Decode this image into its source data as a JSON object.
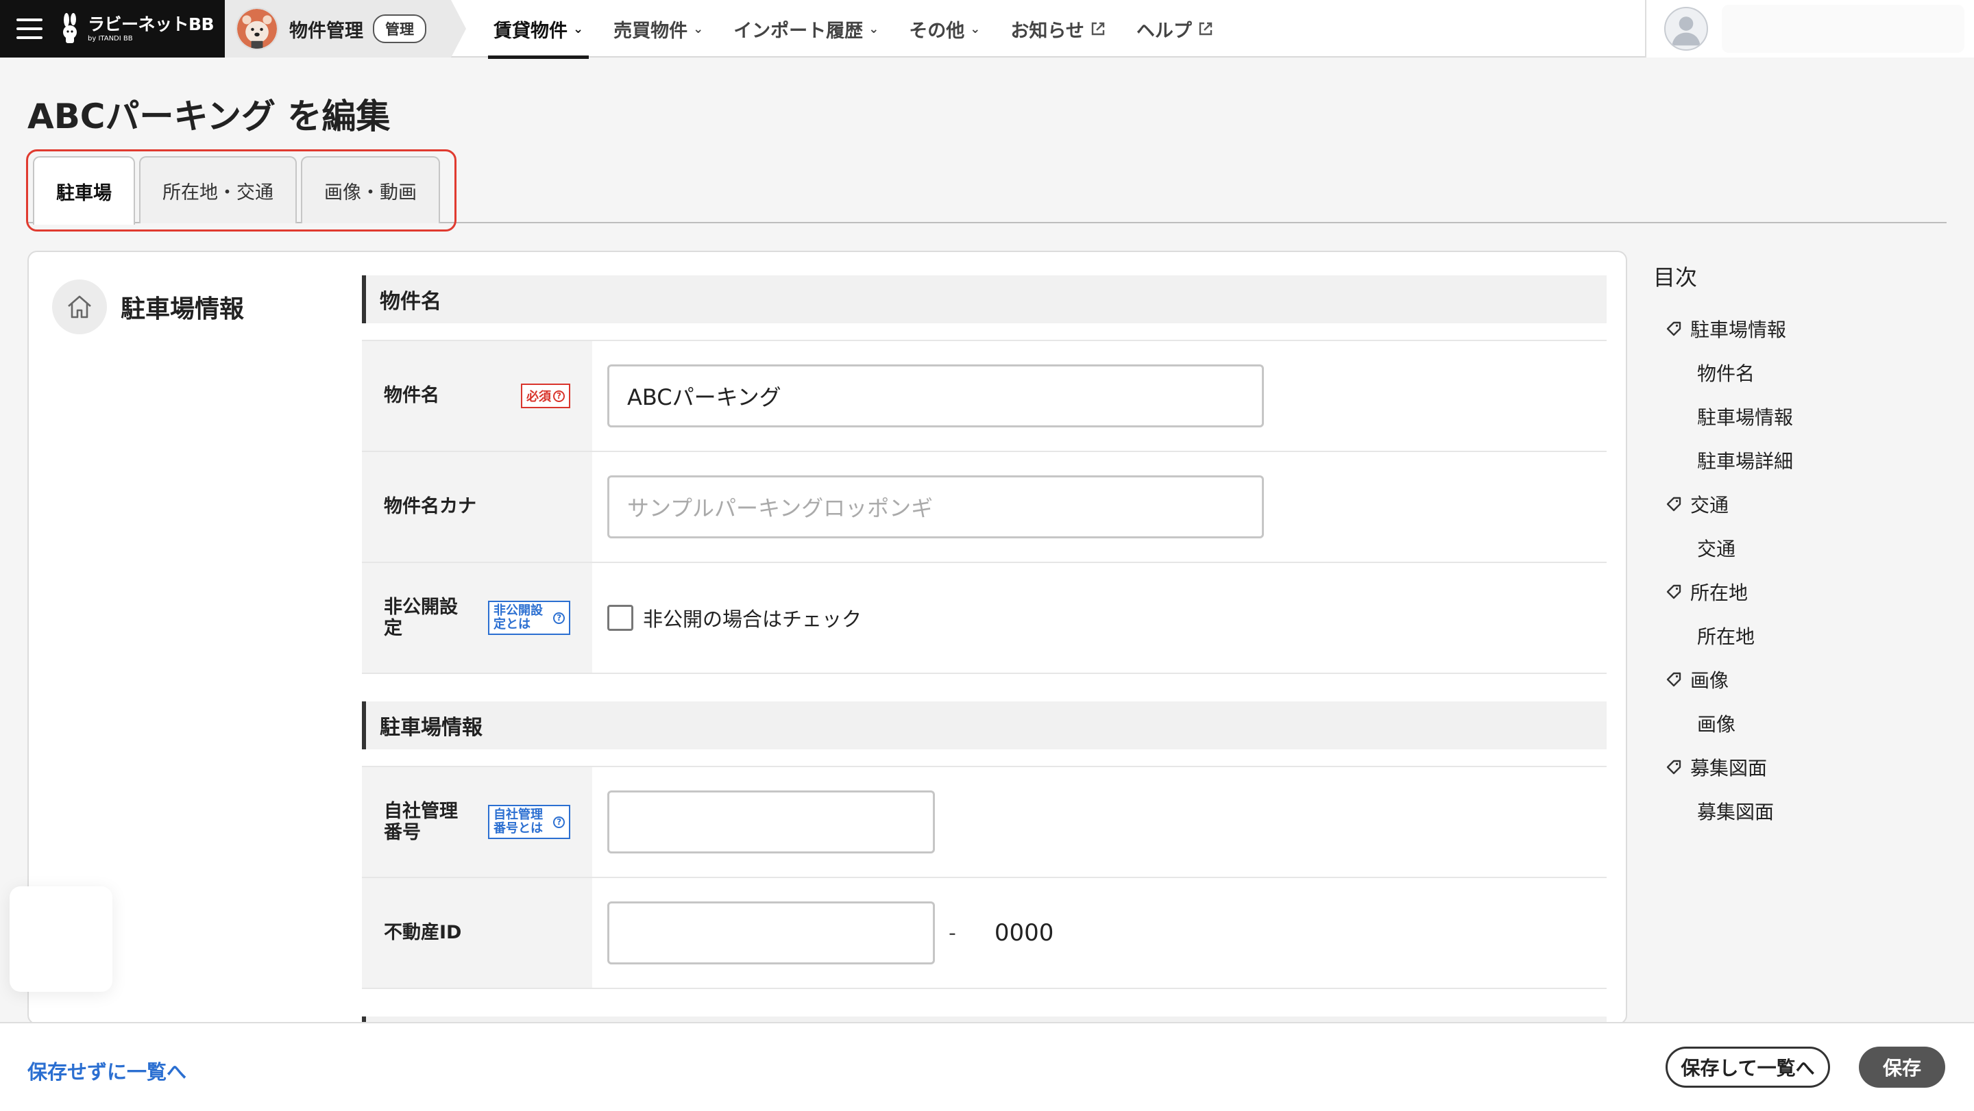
{
  "header": {
    "logo_main": "ラビーネットBB",
    "logo_sub": "by ITANDI BB",
    "crumb_title": "物件管理",
    "crumb_badge": "管理",
    "nav": [
      {
        "label": "賃貸物件",
        "icon": "chevron-down-icon",
        "active": true
      },
      {
        "label": "売買物件",
        "icon": "chevron-down-icon"
      },
      {
        "label": "インポート履歴",
        "icon": "chevron-down-icon"
      },
      {
        "label": "その他",
        "icon": "chevron-down-icon"
      },
      {
        "label": "お知らせ",
        "icon": "external-link-icon"
      },
      {
        "label": "ヘルプ",
        "icon": "external-link-icon"
      }
    ]
  },
  "page": {
    "title": "ABCパーキング を編集",
    "tabs": [
      {
        "label": "駐車場",
        "active": true
      },
      {
        "label": "所在地・交通"
      },
      {
        "label": "画像・動画"
      }
    ]
  },
  "section": {
    "title": "駐車場情報",
    "groups": [
      {
        "title": "物件名",
        "rows": {
          "name": {
            "label": "物件名",
            "badge": "必須",
            "value": "ABCパーキング"
          },
          "kana": {
            "label": "物件名カナ",
            "placeholder": "サンプルパーキングロッポンギ"
          },
          "private": {
            "label": "非公開設定",
            "badge": "非公開設定とは",
            "checkbox_label": "非公開の場合はチェック",
            "checked": false
          }
        }
      },
      {
        "title": "駐車場情報",
        "rows": {
          "mgmt_no": {
            "label": "自社管理番号",
            "badge": "自社管理番号とは",
            "value": ""
          },
          "estate_id": {
            "label": "不動産ID",
            "value": "",
            "separator": "-",
            "suffix": "0000"
          }
        }
      }
    ]
  },
  "toc": {
    "title": "目次",
    "items": [
      {
        "label": "駐車場情報",
        "level": 1
      },
      {
        "label": "物件名",
        "level": 2
      },
      {
        "label": "駐車場情報",
        "level": 2
      },
      {
        "label": "駐車場詳細",
        "level": 2
      },
      {
        "label": "交通",
        "level": 1
      },
      {
        "label": "交通",
        "level": 2
      },
      {
        "label": "所在地",
        "level": 1
      },
      {
        "label": "所在地",
        "level": 2
      },
      {
        "label": "画像",
        "level": 1
      },
      {
        "label": "画像",
        "level": 2
      },
      {
        "label": "募集図面",
        "level": 1
      },
      {
        "label": "募集図面",
        "level": 2
      }
    ]
  },
  "footer": {
    "back_link": "保存せずに一覧へ",
    "save_back": "保存して一覧へ",
    "save": "保存"
  },
  "colors": {
    "accent_link": "#2b6fd1",
    "required": "#d9352c",
    "highlight": "#e03b30",
    "dark_button": "#555555"
  }
}
